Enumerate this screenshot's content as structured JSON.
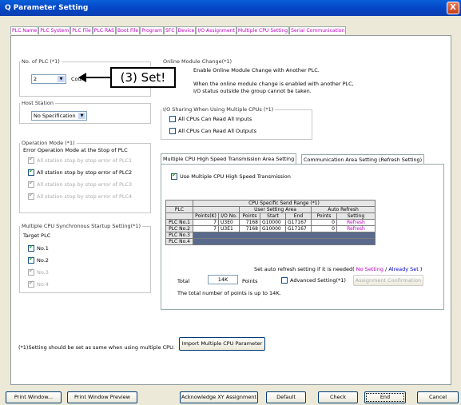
{
  "window": {
    "title": "Q Parameter Setting",
    "close": "X"
  },
  "tabs": [
    "PLC Name",
    "PLC System",
    "PLC File",
    "PLC RAS",
    "Boot File",
    "Program",
    "SFC",
    "Device",
    "I/O Assignment",
    "Multiple CPU Setting",
    "Serial Communication"
  ],
  "num_plc": {
    "legend": "No. of PLC (*1)",
    "value": "2",
    "unit": "Count"
  },
  "callout": "(3) Set!",
  "online": {
    "legend": "Online Module Change(*1)",
    "checkbox": "Enable Online Module Change with Another PLC.",
    "note1": "When the online module change is enabled with another PLC,",
    "note2": "I/O status outside the group cannot be taken."
  },
  "host": {
    "legend": "Host Station",
    "value": "No Specification"
  },
  "io_sharing": {
    "legend": "I/O Sharing When Using Multiple CPUs (*1)",
    "inputs": "All CPUs Can Read All Inputs",
    "outputs": "All CPUs Can Read All Outputs"
  },
  "opmode": {
    "legend": "Operation Mode (*1)",
    "title": "Error Operation Mode at the Stop of PLC",
    "items": [
      "All station stop by stop error of PLC1",
      "All station stop by stop error of PLC2",
      "All station stop by stop error of PLC3",
      "All station stop by stop error of PLC4"
    ]
  },
  "sync": {
    "legend": "Multiple CPU Synchronous Startup Setting(*1)",
    "target": "Target PLC",
    "items": [
      "No.1",
      "No.2",
      "No.3",
      "No.4"
    ]
  },
  "subtabs": [
    "Multiple CPU High Speed Transmission Area Setting",
    "Communication Area Setting (Refresh Setting)"
  ],
  "use_hs": "Use Multiple CPU High Speed Transmission",
  "grid": {
    "h_range": "CPU Specific Send Range (*1)",
    "h_plc": "PLC",
    "h_user": "User Setting Area",
    "h_auto": "Auto Refresh",
    "cols": [
      "Points(K)",
      "I/O No.",
      "Points",
      "Start",
      "End",
      "Points",
      "Setting"
    ],
    "rows": [
      {
        "plc": "PLC No.1",
        "k": "7",
        "io": "U3E0",
        "pts": "7168",
        "start": "G10000",
        "end": "G17167",
        "ap": "0",
        "set": "Refresh"
      },
      {
        "plc": "PLC No.2",
        "k": "7",
        "io": "U3E1",
        "pts": "7168",
        "start": "G10000",
        "end": "G17167",
        "ap": "0",
        "set": "Refresh"
      },
      {
        "plc": "PLC No.3"
      },
      {
        "plc": "PLC No.4"
      }
    ]
  },
  "auto_refresh_note": "Set auto refresh setting if it is needed(",
  "no_setting": "No Setting",
  "slash": "/",
  "already_set": "Already Set",
  "close_paren": ")",
  "total_label": "Total",
  "total_value": "14K",
  "total_unit": "Points",
  "advanced": "Advanced Setting(*1)",
  "assign_confirm": "Assignment Confirmation",
  "max_note": "The total number of points is up to 14K.",
  "footnote": "(*1)Setting should be set as same when using multiple CPU.",
  "import_btn": "Import Multiple CPU Parameter",
  "bottom": {
    "print_window": "Print Window...",
    "print_preview": "Print Window Preview",
    "ack_xy": "Acknowledge XY Assignment",
    "default": "Default",
    "check": "Check",
    "end": "End",
    "cancel": "Cancel"
  }
}
